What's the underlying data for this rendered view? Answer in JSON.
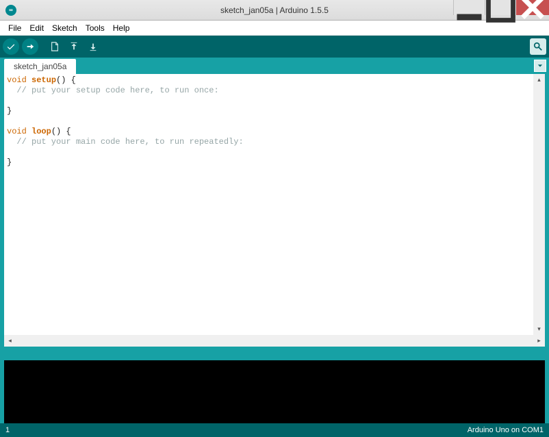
{
  "window": {
    "title": "sketch_jan05a | Arduino 1.5.5",
    "app_icon_text": "∞"
  },
  "menubar": [
    "File",
    "Edit",
    "Sketch",
    "Tools",
    "Help"
  ],
  "tabs": [
    {
      "label": "sketch_jan05a"
    }
  ],
  "code": {
    "l1_kw": "void",
    "l1_fn": "setup",
    "l1_rest": "() {",
    "l2": "  // put your setup code here, to run once:",
    "l3": "",
    "l4": "}",
    "l5": "",
    "l6_kw": "void",
    "l6_fn": "loop",
    "l6_rest": "() {",
    "l7": "  // put your main code here, to run repeatedly:",
    "l8": "",
    "l9": "}"
  },
  "footer": {
    "line": "1",
    "board": "Arduino Uno on COM1"
  }
}
